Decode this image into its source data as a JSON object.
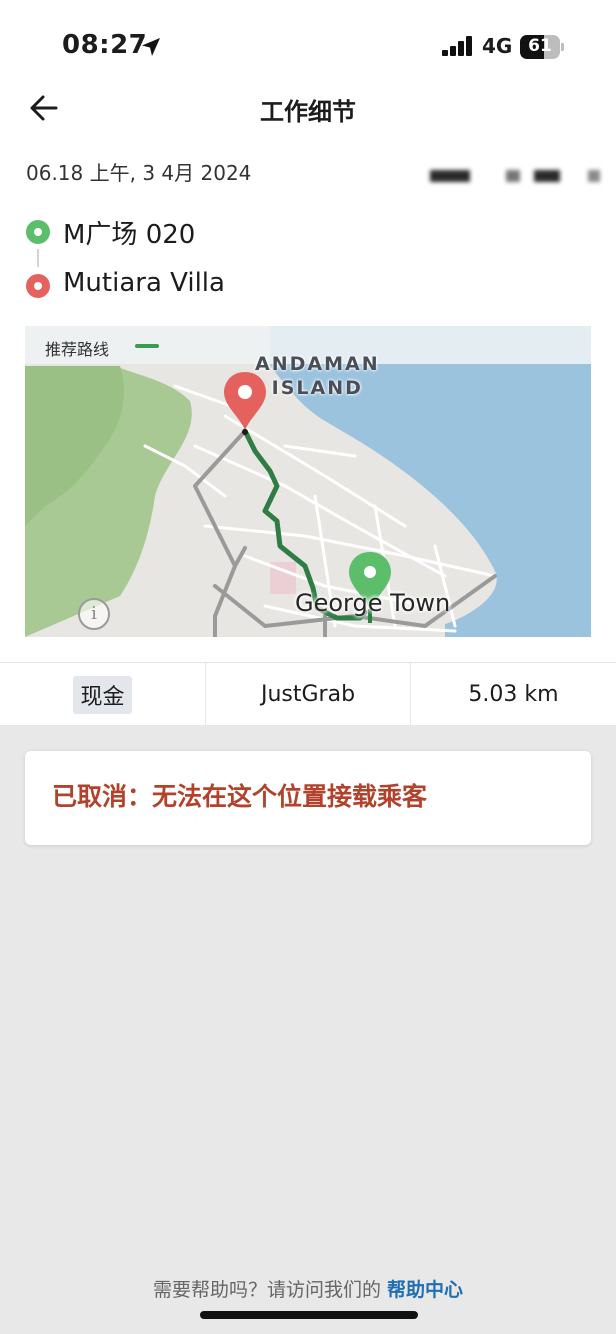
{
  "status_bar": {
    "time": "08:27",
    "network": "4G",
    "battery": "61",
    "battery_level": 0.61
  },
  "header": {
    "title": "工作细节"
  },
  "trip": {
    "date": "06.18 上午, 3 4月 2024",
    "pickup": "M广场 020",
    "dropoff": "Mutiara Villa"
  },
  "map": {
    "legend_label": "推荐路线",
    "island_label_line1": "ANDAMAN",
    "island_label_line2": "ISLAND",
    "town_label": "George Town",
    "route_color": "#2f7d45"
  },
  "details": {
    "payment": "现金",
    "service": "JustGrab",
    "distance": "5.03 km"
  },
  "cancel_message": "已取消：无法在这个位置接载乘客",
  "footer": {
    "prefix": "需要帮助吗？请访问我们的 ",
    "link": "帮助中心"
  },
  "colors": {
    "pickup": "#5cbd6b",
    "dropoff": "#e4615e",
    "cancel_text": "#b3422c",
    "link": "#1e6fb3"
  }
}
